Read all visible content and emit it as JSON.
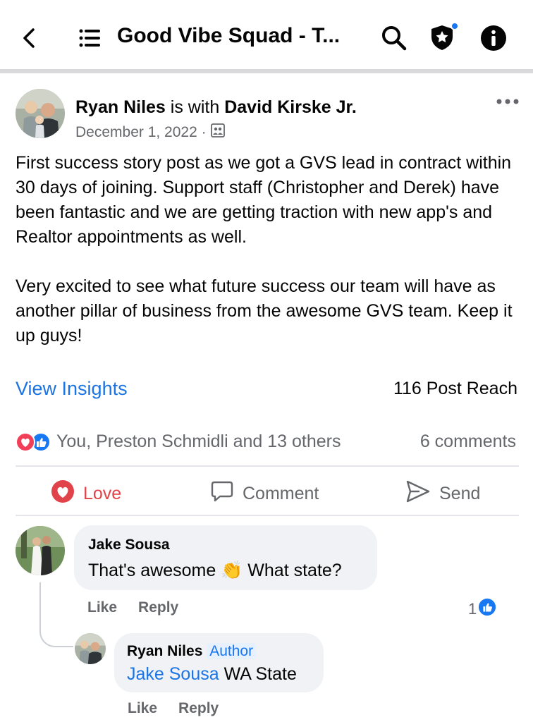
{
  "header": {
    "title": "Good Vibe Squad - T..."
  },
  "post": {
    "author": "Ryan Niles",
    "with_text": "is with",
    "tagged": "David Kirske Jr.",
    "date": "December 1, 2022 ·",
    "body": [
      "First success story post as we got a GVS lead in contract within 30 days of joining. Support staff (Christopher and Derek) have been fantastic and we are getting traction with new app's and Realtor appointments as well.",
      "Very excited to see what future success our team will have as another pillar of business from the awesome GVS team. Keep it up guys!"
    ],
    "insights_label": "View Insights",
    "reach": "116 Post Reach",
    "reactions_text": "You, Preston Schmidli and 13 others",
    "comments_count": "6 comments"
  },
  "actions": {
    "love": "Love",
    "comment": "Comment",
    "send": "Send"
  },
  "comments": [
    {
      "name": "Jake Sousa",
      "text_before": "That's awesome",
      "emoji": "👏",
      "text_after": "What state?",
      "like": "Like",
      "reply": "Reply",
      "reaction_count": "1"
    },
    {
      "name": "Ryan Niles",
      "badge": "Author",
      "mention": "Jake Sousa",
      "text": "WA State",
      "like": "Like",
      "reply": "Reply"
    }
  ],
  "colors": {
    "link_blue": "#1b74e4",
    "love_red": "#e0434a",
    "muted": "#65676b",
    "bubble": "#f0f2f5"
  }
}
